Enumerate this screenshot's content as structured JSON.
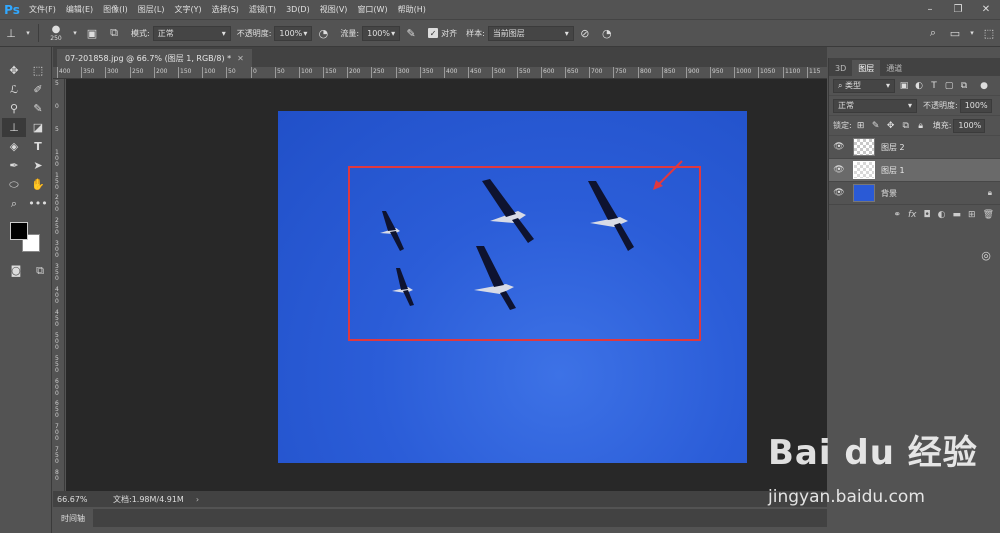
{
  "menubar": {
    "logo": "Ps",
    "items": [
      "文件(F)",
      "编辑(E)",
      "图像(I)",
      "图层(L)",
      "文字(Y)",
      "选择(S)",
      "滤镜(T)",
      "3D(D)",
      "视图(V)",
      "窗口(W)",
      "帮助(H)"
    ]
  },
  "optbar": {
    "brush_size": "250",
    "mode_label": "模式:",
    "mode_value": "正常",
    "opacity_label": "不透明度:",
    "opacity_value": "100%",
    "flow_label": "流量:",
    "flow_value": "100%",
    "align_label": "对齐",
    "sample_label": "样本:",
    "sample_value": "当前图层"
  },
  "document": {
    "tab_title": "07-201858.jpg @ 66.7% (图层 1, RGB/8) *",
    "zoom": "66.67%",
    "doc_info": "文档:1.98M/4.91M"
  },
  "ruler": {
    "h_labels": [
      "400",
      "350",
      "300",
      "250",
      "200",
      "150",
      "100",
      "50",
      "0",
      "50",
      "100",
      "150",
      "200",
      "250",
      "300",
      "350",
      "400",
      "450",
      "500",
      "550",
      "600",
      "650",
      "700",
      "750",
      "800",
      "850",
      "900",
      "950",
      "1000",
      "1050",
      "1100",
      "115"
    ],
    "v_labels": [
      "5",
      "0",
      "5",
      "1 0 0",
      "1 5 0",
      "2 0 0",
      "2 5 0",
      "3 0 0",
      "3 5 0",
      "4 0 0",
      "4 5 0",
      "5 0 0",
      "5 5 0",
      "6 0 0",
      "6 5 0",
      "7 0 0",
      "7 5 0",
      "8 0"
    ]
  },
  "timeline": {
    "label": "时间轴"
  },
  "layers_panel": {
    "tabs": [
      "3D",
      "图层",
      "通道"
    ],
    "kind_filter": "类型",
    "blend_mode": "正常",
    "opacity_label": "不透明度:",
    "opacity_value": "100%",
    "lock_label": "锁定:",
    "fill_label": "填充:",
    "fill_value": "100%",
    "layers": [
      {
        "name": "图层 2",
        "thumb": "checker",
        "selected": false
      },
      {
        "name": "图层 1",
        "thumb": "birds",
        "selected": true
      },
      {
        "name": "背景",
        "thumb": "blue",
        "selected": false
      }
    ]
  },
  "watermark": {
    "logo": "Bai du 经验",
    "url": "jingyan.baidu.com"
  },
  "colors": {
    "canvas_blue": "#2b5dd8",
    "selection_red": "#e0383f",
    "ps_blue": "#31a8ff"
  }
}
